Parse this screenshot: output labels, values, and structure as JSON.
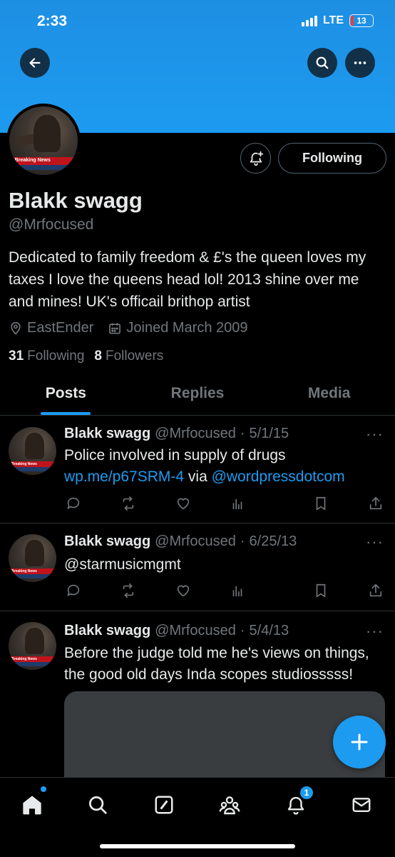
{
  "status_bar": {
    "time": "2:33",
    "network": "LTE",
    "battery": "13"
  },
  "header": {
    "back_icon": "arrow-left-icon",
    "search_icon": "search-icon",
    "more_icon": "more-horizontal-icon"
  },
  "profile": {
    "avatar_caption": "Breaking News",
    "follow_button": "Following",
    "display_name": "Blakk swagg",
    "handle": "@Mrfocused",
    "bio": "Dedicated to family freedom & £'s the queen loves my taxes I love the queens head lol! 2013 shine over me and mines! UK's officail brithop artist",
    "location": "EastEnder",
    "joined": "Joined March 2009",
    "following_count": "31",
    "following_label": "Following",
    "followers_count": "8",
    "followers_label": "Followers"
  },
  "tabs": [
    {
      "label": "Posts",
      "active": true
    },
    {
      "label": "Replies",
      "active": false
    },
    {
      "label": "Media",
      "active": false
    }
  ],
  "posts": [
    {
      "name": "Blakk swagg",
      "handle": "@Mrfocused",
      "date": "5/1/15",
      "text_before": "Police involved in supply of drugs ",
      "link1": "wp.me/p67SRM-4",
      "text_middle": " via ",
      "link2": "@wordpressdotcom"
    },
    {
      "name": "Blakk swagg",
      "handle": "@Mrfocused",
      "date": "6/25/13",
      "text": "@starmusicmgmt"
    },
    {
      "name": "Blakk swagg",
      "handle": "@Mrfocused",
      "date": "5/4/13",
      "text": "Before the judge told me he's views on things, the good old days Inda scopes studiosssss!"
    }
  ],
  "separator": "·",
  "more_glyph": "···",
  "notifications_badge": "1",
  "colors": {
    "accent": "#1d9bf0",
    "background": "#000000",
    "secondary_text": "#71767b"
  }
}
